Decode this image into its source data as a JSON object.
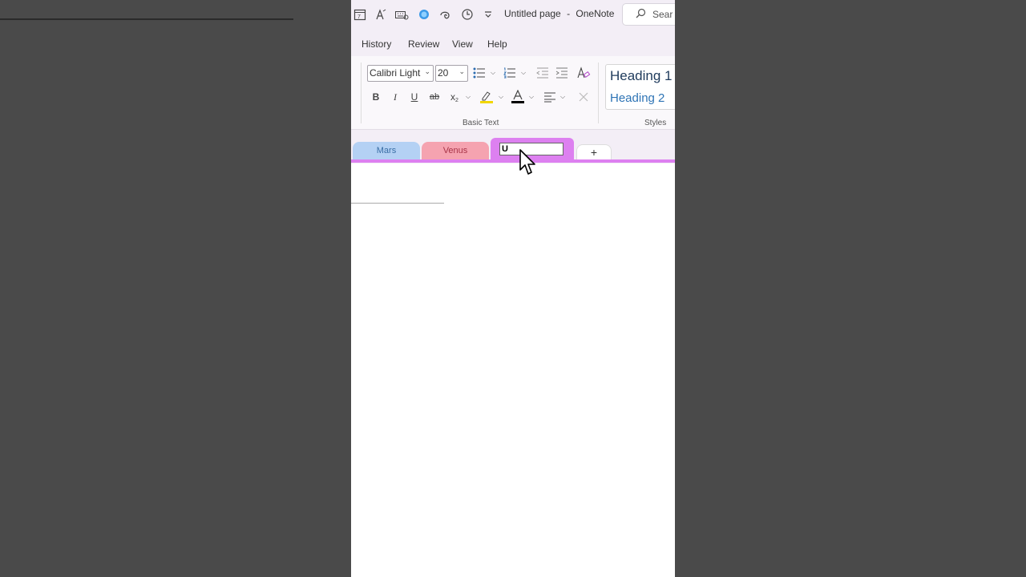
{
  "window": {
    "title": "Untitled page",
    "separator": "-",
    "app_name": "OneNote",
    "search_placeholder": "Sear"
  },
  "quick_access": [
    "calendar-icon",
    "font-icon",
    "keyboard-icon",
    "copilot-icon",
    "touch-icon",
    "clock-icon",
    "customize-icon"
  ],
  "menu": {
    "items": [
      "History",
      "Review",
      "View",
      "Help"
    ]
  },
  "ribbon": {
    "font_name": "Calibri Light",
    "font_size": "20",
    "bold": "B",
    "italic": "I",
    "underline": "U",
    "strikethrough": "ab",
    "subscript": "x",
    "font_color_glyph": "A",
    "basic_text_label": "Basic Text",
    "styles_label": "Styles",
    "heading1": "Heading 1",
    "heading2": "Heading 2",
    "highlight_color": "#f2d600",
    "font_color": "#000000"
  },
  "sections": {
    "tabs": [
      {
        "label": "Mars",
        "color": "#b4d1f4",
        "text_color": "#3a6ea5"
      },
      {
        "label": "Venus",
        "color": "#f5a3b0",
        "text_color": "#a83448"
      }
    ],
    "active_tab": {
      "input_value": "U",
      "color": "#dd80f0"
    },
    "add_label": "+"
  }
}
